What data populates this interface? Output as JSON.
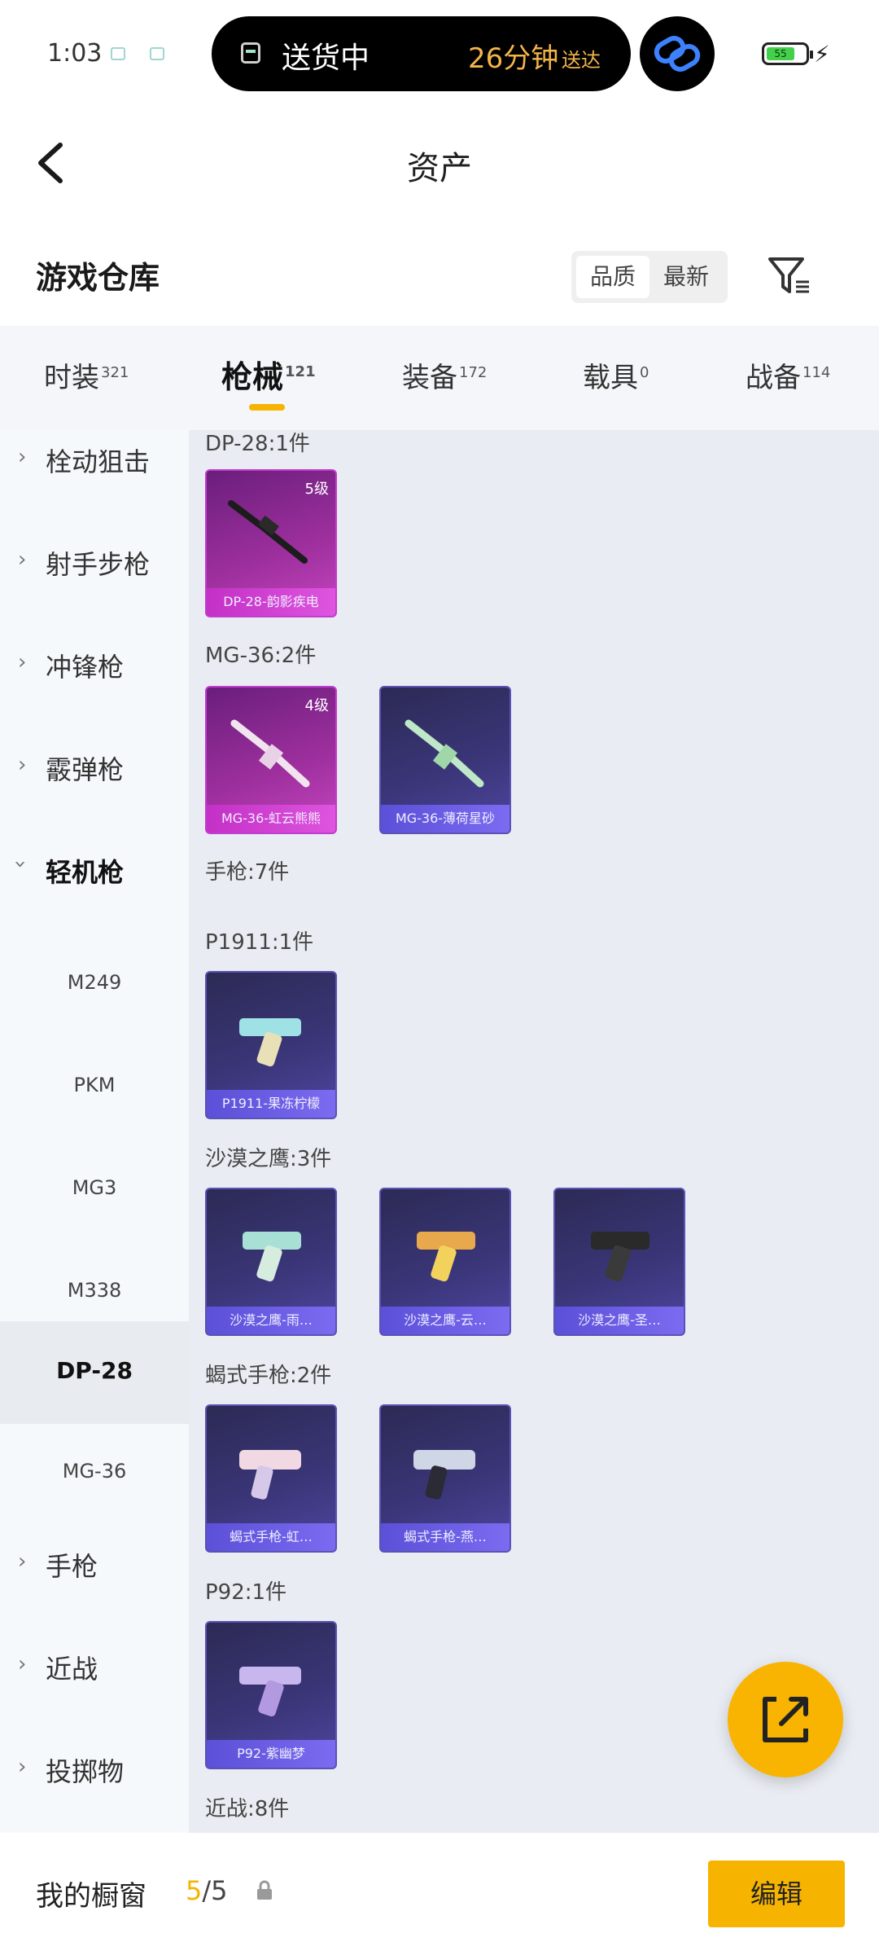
{
  "status_bar": {
    "time": "1:03",
    "live_activity_text": "送货中",
    "eta_text": "26分钟",
    "eta_suffix": "送达",
    "battery_level": "55"
  },
  "header": {
    "title": "资产"
  },
  "section": {
    "title": "游戏仓库",
    "sort_options": [
      "品质",
      "最新"
    ],
    "active_sort": "品质"
  },
  "tabs": [
    {
      "label": "时装",
      "count": "321"
    },
    {
      "label": "枪械",
      "count": "121"
    },
    {
      "label": "装备",
      "count": "172"
    },
    {
      "label": "载具",
      "count": "0"
    },
    {
      "label": "战备",
      "count": "114"
    }
  ],
  "active_tab": "枪械",
  "sidebar": {
    "categories_top": [
      "栓动狙击",
      "射手步枪",
      "冲锋枪",
      "霰弹枪",
      "轻机枪"
    ],
    "subitems": [
      "M249",
      "PKM",
      "MG3",
      "M338",
      "DP-28",
      "MG-36"
    ],
    "selected_subitem": "DP-28",
    "categories_bottom": [
      "手枪",
      "近战",
      "投掷物"
    ]
  },
  "content": {
    "groups": [
      {
        "label": "DP-28:1件",
        "items": [
          {
            "name": "DP-28-韵影疾电",
            "level": "5级",
            "rarity": "pink"
          }
        ]
      },
      {
        "label": "MG-36:2件",
        "items": [
          {
            "name": "MG-36-虹云熊熊",
            "level": "4级",
            "rarity": "pink"
          },
          {
            "name": "MG-36-薄荷星砂",
            "level": "",
            "rarity": "purple"
          }
        ]
      },
      {
        "label": "手枪:7件",
        "items": []
      },
      {
        "label": "P1911:1件",
        "items": [
          {
            "name": "P1911-果冻柠檬",
            "level": "",
            "rarity": "purple"
          }
        ]
      },
      {
        "label": "沙漠之鹰:3件",
        "items": [
          {
            "name": "沙漠之鹰-雨…",
            "level": "",
            "rarity": "purple"
          },
          {
            "name": "沙漠之鹰-云…",
            "level": "",
            "rarity": "purple"
          },
          {
            "name": "沙漠之鹰-圣…",
            "level": "",
            "rarity": "purple"
          }
        ]
      },
      {
        "label": "蝎式手枪:2件",
        "items": [
          {
            "name": "蝎式手枪-虹…",
            "level": "",
            "rarity": "purple"
          },
          {
            "name": "蝎式手枪-燕…",
            "level": "",
            "rarity": "purple"
          }
        ]
      },
      {
        "label": "P92:1件",
        "items": [
          {
            "name": "P92-紫幽梦",
            "level": "",
            "rarity": "purple"
          }
        ]
      },
      {
        "label": "近战:8件",
        "items": []
      }
    ]
  },
  "bottom_bar": {
    "label": "我的橱窗",
    "count_current": "5",
    "count_total": "/5",
    "edit_label": "编辑"
  },
  "colors": {
    "accent": "#f6b400",
    "pink_rarity": "#c23cd0",
    "purple_rarity": "#5a52b4"
  }
}
